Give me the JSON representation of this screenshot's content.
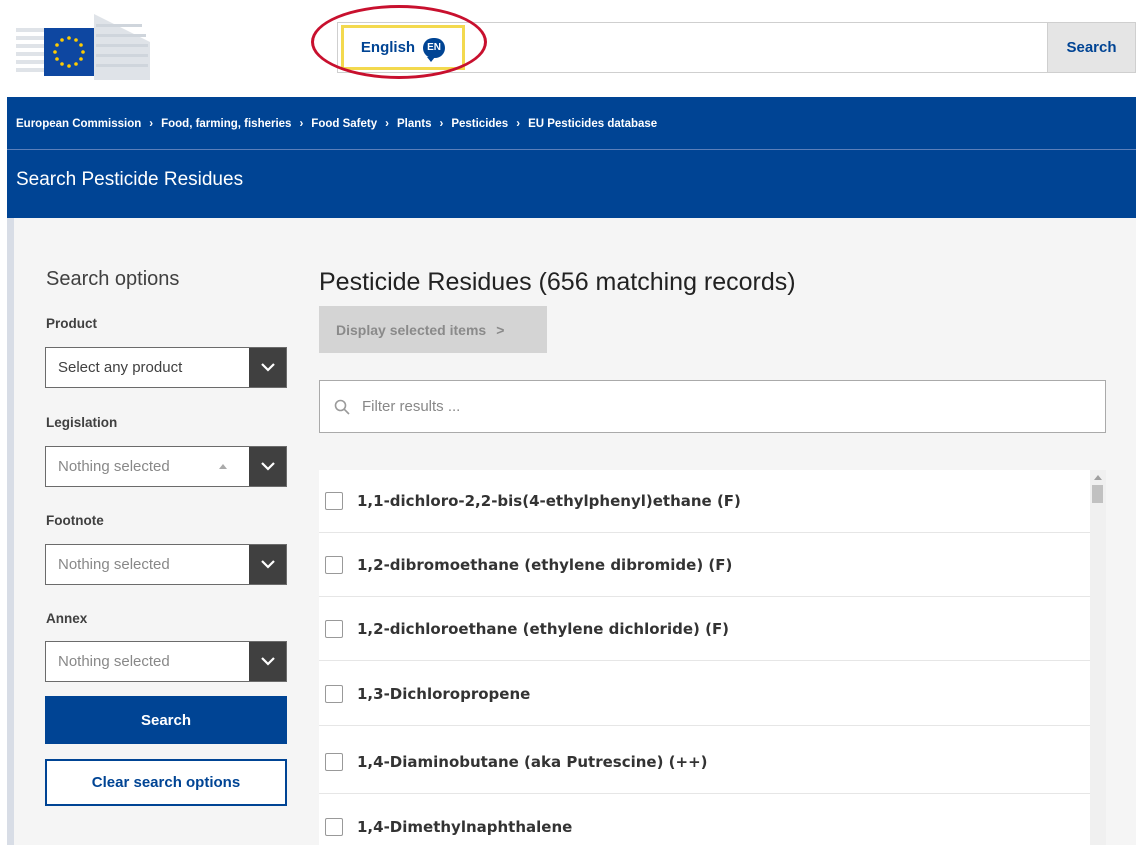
{
  "header": {
    "language_label": "English",
    "language_code": "EN",
    "search_button": "Search"
  },
  "breadcrumb": [
    "European Commission",
    "Food, farming, fisheries",
    "Food Safety",
    "Plants",
    "Pesticides",
    "EU Pesticides database"
  ],
  "page_title": "Search Pesticide Residues",
  "sidebar": {
    "title": "Search options",
    "product": {
      "label": "Product",
      "value": "Select any product"
    },
    "legislation": {
      "label": "Legislation",
      "value": "Nothing selected"
    },
    "footnote": {
      "label": "Footnote",
      "value": "Nothing selected"
    },
    "annex": {
      "label": "Annex",
      "value": "Nothing selected"
    },
    "search_button": "Search",
    "clear_button": "Clear search options"
  },
  "main": {
    "title": "Pesticide Residues (656 matching records)",
    "display_button": "Display selected items",
    "display_button_chevron": ">",
    "filter_placeholder": "Filter results ...",
    "results": [
      "1,1-dichloro-2,2-bis(4-ethylphenyl)ethane (F)",
      "1,2-dibromoethane (ethylene dibromide) (F)",
      "1,2-dichloroethane (ethylene dichloride) (F)",
      "1,3-Dichloropropene",
      "1,4-Diaminobutane (aka Putrescine) (++)",
      "1,4-Dimethylnaphthalene"
    ]
  },
  "colors": {
    "brand_blue": "#004494",
    "highlight_yellow": "#f3d94e",
    "annotation_red": "#c8102e"
  }
}
